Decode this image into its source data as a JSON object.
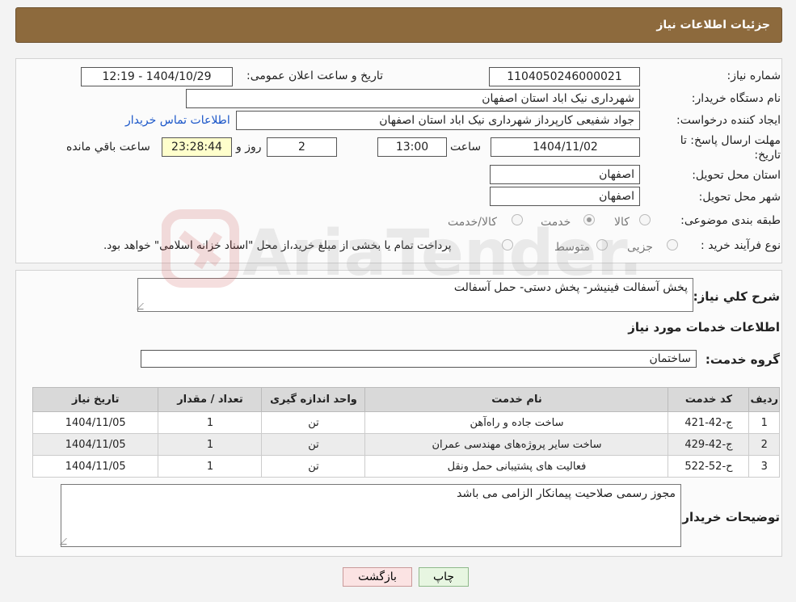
{
  "header": {
    "title": "جزئیات اطلاعات نیاز"
  },
  "form": {
    "need_number_label": "شماره نیاز:",
    "need_number": "1104050246000021",
    "announce_label": "تاریخ و ساعت اعلان عمومی:",
    "announce_value": "1404/10/29 - 12:19",
    "buyer_org_label": "نام دستگاه خریدار:",
    "buyer_org": "شهرداری نیک اباد استان اصفهان",
    "creator_label": "ایجاد کننده درخواست:",
    "creator": "جواد شفیعی کارپرداز شهرداری نیک اباد استان اصفهان",
    "contact_link": "اطلاعات تماس خریدار",
    "deadline_label": "مهلت ارسال پاسخ: تا تاریخ:",
    "deadline_date": "1404/11/02",
    "time_label": "ساعت",
    "deadline_time": "13:00",
    "days_value": "2",
    "days_label": "روز و",
    "remaining_time": "23:28:44",
    "remaining_label": "ساعت باقي مانده",
    "province_label": "استان محل تحویل:",
    "province": "اصفهان",
    "city_label": "شهر محل تحویل:",
    "city": "اصفهان",
    "category_label": "طبقه بندی موضوعی:",
    "category_options": [
      "کالا",
      "خدمت",
      "کالا/خدمت"
    ],
    "category_selected": "خدمت",
    "process_label": "نوع فرآیند خرید :",
    "process_options": [
      "جزیی",
      "متوسط"
    ],
    "process_note": "پرداخت تمام یا بخشی از مبلغ خرید،از محل \"اسناد خزانه اسلامی\" خواهد بود."
  },
  "summary": {
    "label": "شرح كلي نياز:",
    "text": "پخش آسفالت فینیشر- پخش دستی- حمل آسفالت"
  },
  "services": {
    "section_title": "اطلاعات خدمات مورد نیاز",
    "group_label": "گروه خدمت:",
    "group_value": "ساختمان",
    "columns": [
      "رديف",
      "کد خدمت",
      "نام خدمت",
      "واحد اندازه گیری",
      "تعداد / مقدار",
      "تاریخ نیاز"
    ],
    "rows": [
      [
        "1",
        "ج-42-421",
        "ساخت جاده و راه‌آهن",
        "تن",
        "1",
        "1404/11/05"
      ],
      [
        "2",
        "ج-42-429",
        "ساخت سایر پروژه‌های مهندسی عمران",
        "تن",
        "1",
        "1404/11/05"
      ],
      [
        "3",
        "ح-52-522",
        "فعالیت های پشتیبانی حمل ونقل",
        "تن",
        "1",
        "1404/11/05"
      ]
    ]
  },
  "buyer_notes": {
    "label": "توضیحات خریدار:",
    "text": "مجوز رسمی  صلاحیت پیمانکار الزامی می باشد"
  },
  "buttons": {
    "print": "چاپ",
    "back": "بازگشت"
  },
  "watermark": {
    "text": "AriaTender.neT"
  },
  "colors": {
    "header": "#8d6a3d",
    "print_button": "#e7f6e1",
    "back_button": "#fbe3e3",
    "link": "#1a56c9"
  }
}
